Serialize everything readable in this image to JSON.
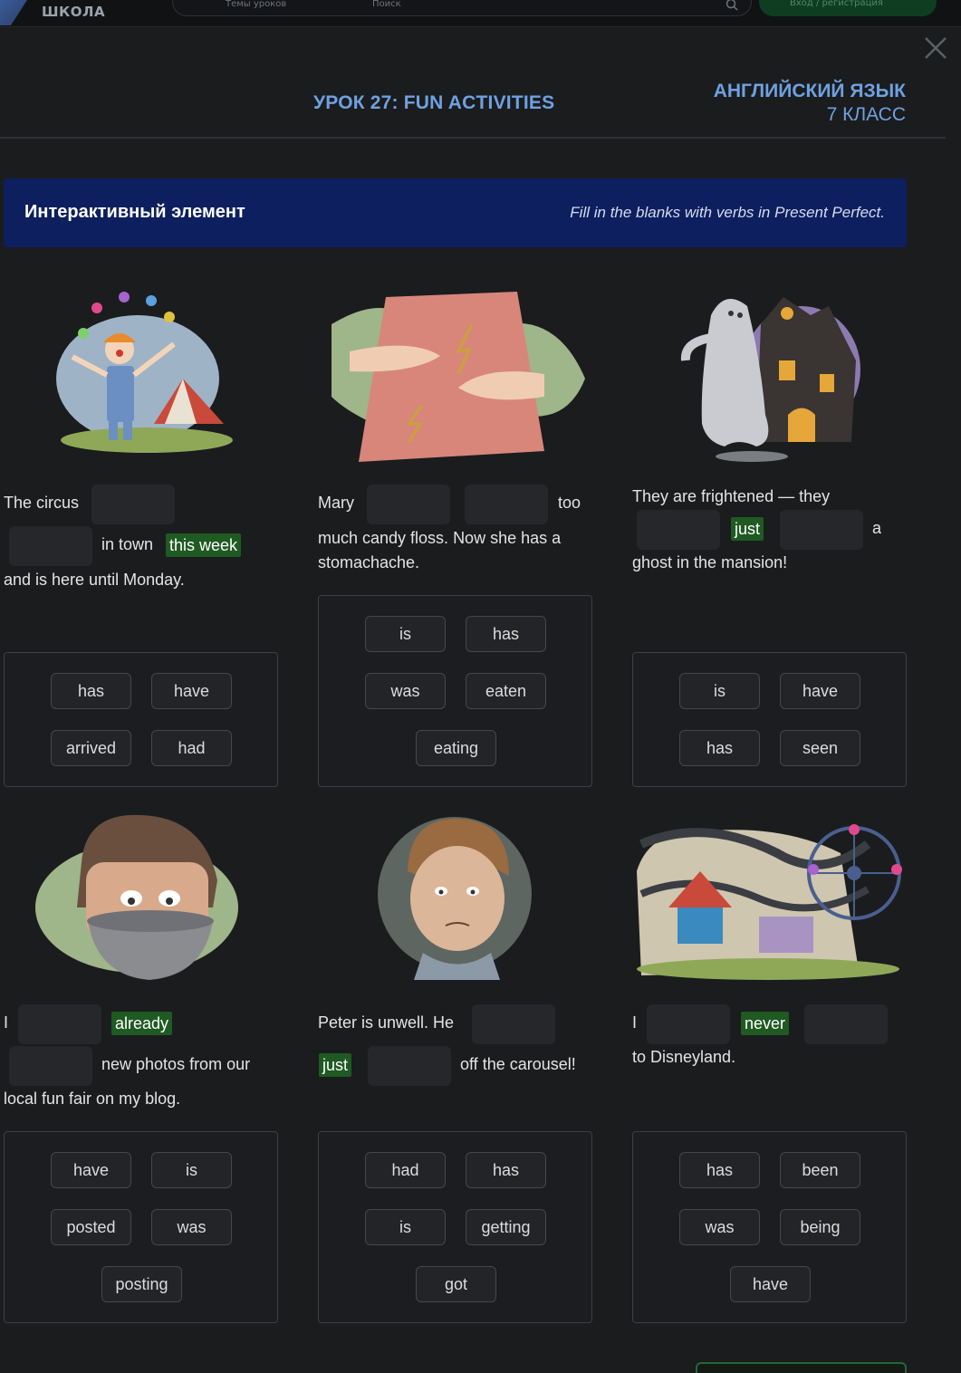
{
  "nav": {
    "logo_text": "ШКОЛА",
    "search_tab_topics": "Темы уроков",
    "search_tab_search": "Поиск",
    "login_label": "Вход / регистрация"
  },
  "header": {
    "lesson_title": "УРОК 27: FUN ACTIVITIES",
    "subject_line1": "АНГЛИЙСКИЙ ЯЗЫК",
    "subject_line2": "7 КЛАСС"
  },
  "banner": {
    "title": "Интерактивный элемент",
    "instruction": "Fill in the blanks with verbs in Present Perfect."
  },
  "exercises": [
    {
      "illustration": "clown-circus-illustration",
      "text": {
        "a": "The circus",
        "b": "in town",
        "highlight1": "this week",
        "c": "and is here until Monday."
      },
      "options": [
        "has",
        "have",
        "arrived",
        "had"
      ]
    },
    {
      "illustration": "stomach-ache-illustration",
      "text": {
        "a": "Mary",
        "b": "too",
        "c": "much candy floss. Now she has a",
        "d": "stomachache."
      },
      "options": [
        "is",
        "has",
        "was",
        "eaten",
        "eating"
      ]
    },
    {
      "illustration": "ghost-mansion-illustration",
      "text": {
        "a": "They are frightened — they",
        "highlight1": "just",
        "b": "a",
        "c": "ghost in the mansion!"
      },
      "options": [
        "is",
        "have",
        "has",
        "seen"
      ]
    },
    {
      "illustration": "boy-with-bowl-illustration",
      "text": {
        "a": "I",
        "highlight1": "already",
        "b": "new photos from our",
        "c": "local fun fair on my blog."
      },
      "options": [
        "have",
        "is",
        "posted",
        "was",
        "posting"
      ]
    },
    {
      "illustration": "sick-boy-illustration",
      "text": {
        "a": "Peter is unwell. He",
        "highlight1": "just",
        "b": "off the carousel!"
      },
      "options": [
        "had",
        "has",
        "is",
        "getting",
        "got"
      ]
    },
    {
      "illustration": "amusement-park-illustration",
      "text": {
        "a": "I",
        "highlight1": "never",
        "b": "to Disneyland."
      },
      "options": [
        "has",
        "been",
        "was",
        "being",
        "have"
      ]
    }
  ]
}
